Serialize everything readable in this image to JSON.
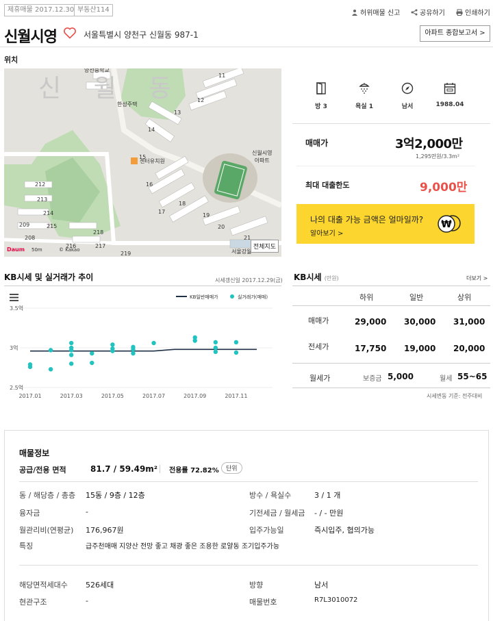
{
  "header": {
    "tag1": "제휴매물 2017.12.30",
    "tag2": "부동산114",
    "report_false": "허위매물 신고",
    "share": "공유하기",
    "print": "인쇄하기",
    "title": "신월시영",
    "address": "서울특별시 양천구 신월동 987-1",
    "report_btn": "아파트 종합보고서 >",
    "location_label": "위치"
  },
  "map": {
    "watermark": "신 월 동",
    "place_hanseong": "한성주택",
    "place_center": "센터유치원",
    "place_apt": "신월시영\n아파트",
    "place_school": "양천중학교",
    "place_seoul": "서울강월",
    "full_map": "전체지도",
    "logo": "Daum",
    "scale": "50m",
    "kakao": "© Kakao",
    "building_numbers": [
      "11",
      "12",
      "13",
      "14",
      "15",
      "16",
      "17",
      "18",
      "19",
      "20",
      "21",
      "208",
      "209",
      "212",
      "213",
      "214",
      "215",
      "216",
      "217",
      "218",
      "219"
    ]
  },
  "features": [
    {
      "icon": "door-icon",
      "label": "방 3"
    },
    {
      "icon": "shower-icon",
      "label": "욕실 1"
    },
    {
      "icon": "compass-icon",
      "label": "남서"
    },
    {
      "icon": "calendar-icon",
      "label": "1988.04"
    }
  ],
  "price": {
    "label": "매매가",
    "value": "3억2,000만",
    "per_area": "1,295만원/3.3m²",
    "loan_label": "최대 대출한도",
    "loan_value": "9,000만",
    "banner_question": "나의 대출 가능 금액은 얼마일까?",
    "banner_more": "알아보기 >"
  },
  "kb_chart": {
    "title": "KB시세 및 실거래가 추이",
    "updated": "시세갱신일 2017.12.29(금)",
    "legend_kb": "KB일반매매가",
    "legend_real": "실거래가(매매)"
  },
  "chart_data": {
    "type": "line",
    "title": "KB시세 및 실거래가 추이",
    "ylim": [
      2.5,
      3.5
    ],
    "yticks": [
      "3.5억",
      "3억",
      "2.5억"
    ],
    "xticks": [
      "2017.01",
      "2017.03",
      "2017.05",
      "2017.07",
      "2017.09",
      "2017.11"
    ],
    "series": [
      {
        "name": "KB일반매매가",
        "type": "line",
        "x": [
          0,
          5,
          6,
          7,
          11
        ],
        "y": [
          2.96,
          2.96,
          2.96,
          2.98,
          2.98
        ]
      },
      {
        "name": "실거래가(매매)",
        "type": "scatter",
        "x": [
          0,
          0,
          1,
          1,
          2,
          2,
          2,
          2,
          2,
          3,
          3,
          4,
          4,
          4,
          5,
          5,
          5,
          6,
          8,
          8,
          9,
          9,
          9,
          10,
          10
        ],
        "y": [
          2.76,
          2.79,
          2.73,
          2.97,
          2.91,
          2.97,
          3.0,
          3.06,
          2.8,
          2.93,
          2.81,
          3.04,
          2.99,
          2.96,
          3.01,
          2.98,
          2.93,
          3.06,
          3.13,
          3.09,
          3.07,
          3.0,
          2.95,
          3.07,
          2.94
        ]
      }
    ]
  },
  "kb_table": {
    "title": "KB시세",
    "unit": "(만원)",
    "more": "더보기 >",
    "headers": [
      "하위",
      "일반",
      "상위"
    ],
    "rows": [
      {
        "label": "매매가",
        "values": [
          "29,000",
          "30,000",
          "31,000"
        ]
      },
      {
        "label": "전세가",
        "values": [
          "17,750",
          "19,000",
          "20,000"
        ]
      }
    ],
    "rent_label": "월세가",
    "deposit_label": "보증금",
    "deposit": "5,000",
    "monthly_label": "월세",
    "monthly": "55~65",
    "note": "시세변동 기준: 전주대비"
  },
  "listing": {
    "title": "매물정보",
    "area_label": "공급/전용 면적",
    "area_value": "81.7 / 59.49m²",
    "ratio": "전용률 72.82%",
    "unit_btn": "단위",
    "rows": [
      {
        "l1": "동 / 해당층 / 총층",
        "v1": "15동 / 9층 / 12층",
        "l2": "방수 / 욕실수",
        "v2": "3 / 1 개"
      },
      {
        "l1": "융자금",
        "v1": "-",
        "l2": "기전세금 / 월세금",
        "v2": "- / - 만원"
      },
      {
        "l1": "월관리비(연평균)",
        "v1": "176,967원",
        "l2": "입주가능일",
        "v2": "즉시입주, 협의가능"
      }
    ],
    "feature_label": "특징",
    "feature_value": "급주천매매 지양산 전망 좋고 채광 좋은 조용한 로얄동 조기입주가능",
    "rows2": [
      {
        "l1": "해당면적세대수",
        "v1": "526세대",
        "l2": "방향",
        "v2": "남서"
      },
      {
        "l1": "현관구조",
        "v1": "-",
        "l2": "매물번호",
        "v2": "R7L3010072"
      }
    ]
  }
}
